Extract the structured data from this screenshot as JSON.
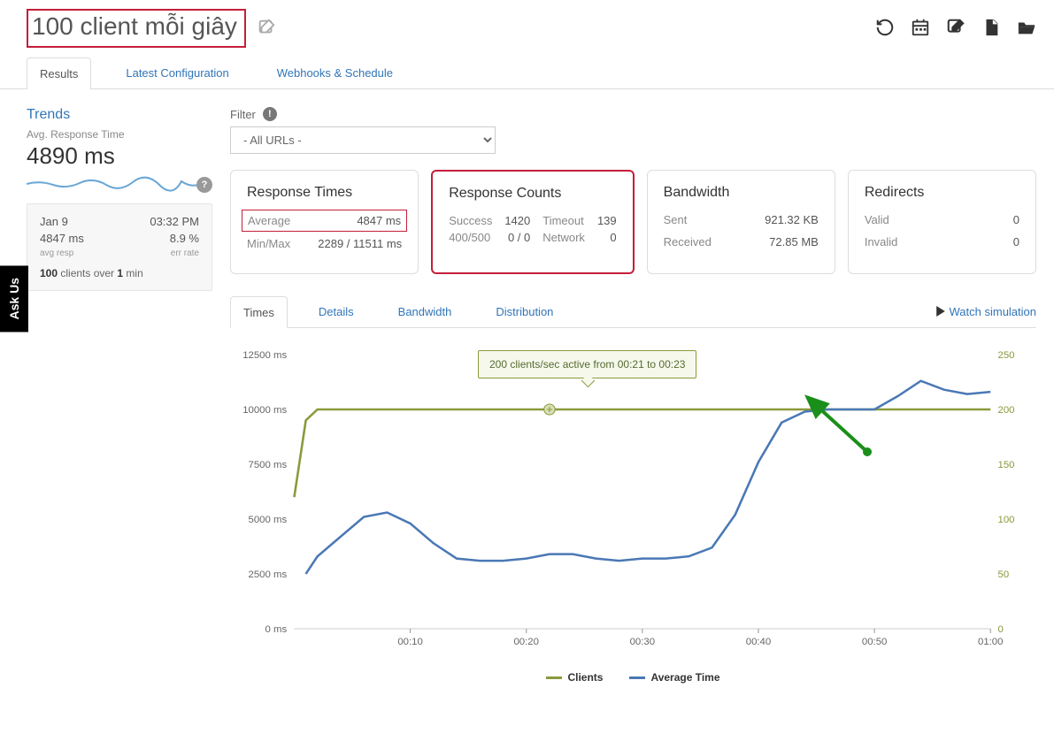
{
  "title": "100 client mỗi giây",
  "main_tabs": [
    "Results",
    "Latest Configuration",
    "Webhooks & Schedule"
  ],
  "active_main_tab": 0,
  "trends": {
    "title": "Trends",
    "subtitle": "Avg. Response Time",
    "value": "4890 ms"
  },
  "run": {
    "date": "Jan 9",
    "time": "03:32 PM",
    "resp": "4847 ms",
    "err": "8.9 %",
    "resp_label": "avg resp",
    "err_label": "err rate",
    "clients_line_1": "100",
    "clients_line_2": " clients over ",
    "clients_line_3": "1",
    "clients_line_4": " min"
  },
  "filter": {
    "label": "Filter",
    "selected": "- All URLs -"
  },
  "cards": {
    "response_times": {
      "title": "Response Times",
      "rows": [
        {
          "label": "Average",
          "value": "4847 ms",
          "boxed": true
        },
        {
          "label": "Min/Max",
          "value": "2289 / 11511 ms",
          "boxed": false
        }
      ]
    },
    "response_counts": {
      "title": "Response Counts",
      "grid": [
        {
          "l": "Success",
          "v": "1420"
        },
        {
          "l": "Timeout",
          "v": "139"
        },
        {
          "l": "400/500",
          "v": "0 / 0"
        },
        {
          "l": "Network",
          "v": "0"
        }
      ]
    },
    "bandwidth": {
      "title": "Bandwidth",
      "rows": [
        {
          "label": "Sent",
          "value": "921.32 KB"
        },
        {
          "label": "Received",
          "value": "72.85 MB"
        }
      ]
    },
    "redirects": {
      "title": "Redirects",
      "rows": [
        {
          "label": "Valid",
          "value": "0"
        },
        {
          "label": "Invalid",
          "value": "0"
        }
      ]
    }
  },
  "sub_tabs": [
    "Times",
    "Details",
    "Bandwidth",
    "Distribution"
  ],
  "active_sub_tab": 0,
  "watch_link": "Watch simulation",
  "tooltip_text": "200 clients/sec active from 00:21 to 00:23",
  "legend": {
    "clients": "Clients",
    "avg": "Average Time"
  },
  "ask_us": "Ask Us",
  "chart_data": {
    "type": "line",
    "xlabel": "",
    "ylabel_left": "ms",
    "ylabel_right": "clients",
    "x_ticks": [
      "00:10",
      "00:20",
      "00:30",
      "00:40",
      "00:50",
      "01:00"
    ],
    "y_left_ticks": [
      "0 ms",
      "2500 ms",
      "5000 ms",
      "7500 ms",
      "10000 ms",
      "12500 ms"
    ],
    "y_right_ticks": [
      "0",
      "50",
      "100",
      "150",
      "200",
      "250"
    ],
    "ylim_left": [
      0,
      12500
    ],
    "ylim_right": [
      0,
      250
    ],
    "series": [
      {
        "name": "Clients",
        "axis": "right",
        "color": "#8a9a3b",
        "x": [
          0,
          1,
          2,
          60
        ],
        "values": [
          120,
          190,
          200,
          200
        ]
      },
      {
        "name": "Average Time",
        "axis": "left",
        "color": "#4a78b5",
        "x": [
          1,
          2,
          4,
          6,
          8,
          10,
          12,
          14,
          16,
          18,
          20,
          22,
          24,
          26,
          28,
          30,
          32,
          34,
          36,
          38,
          40,
          42,
          44,
          46,
          48,
          50,
          52,
          54,
          56,
          58,
          60
        ],
        "values": [
          2500,
          3300,
          4200,
          5100,
          5300,
          4800,
          3900,
          3200,
          3100,
          3100,
          3200,
          3400,
          3400,
          3200,
          3100,
          3200,
          3200,
          3300,
          3700,
          5200,
          7600,
          9400,
          9900,
          10000,
          10000,
          10000,
          10600,
          11300,
          10900,
          10700,
          10800
        ]
      }
    ],
    "annotations": [
      {
        "type": "tooltip",
        "text": "200 clients/sec active from 00:21 to 00:23"
      },
      {
        "type": "arrow",
        "color": "#1a8f1a"
      }
    ]
  }
}
